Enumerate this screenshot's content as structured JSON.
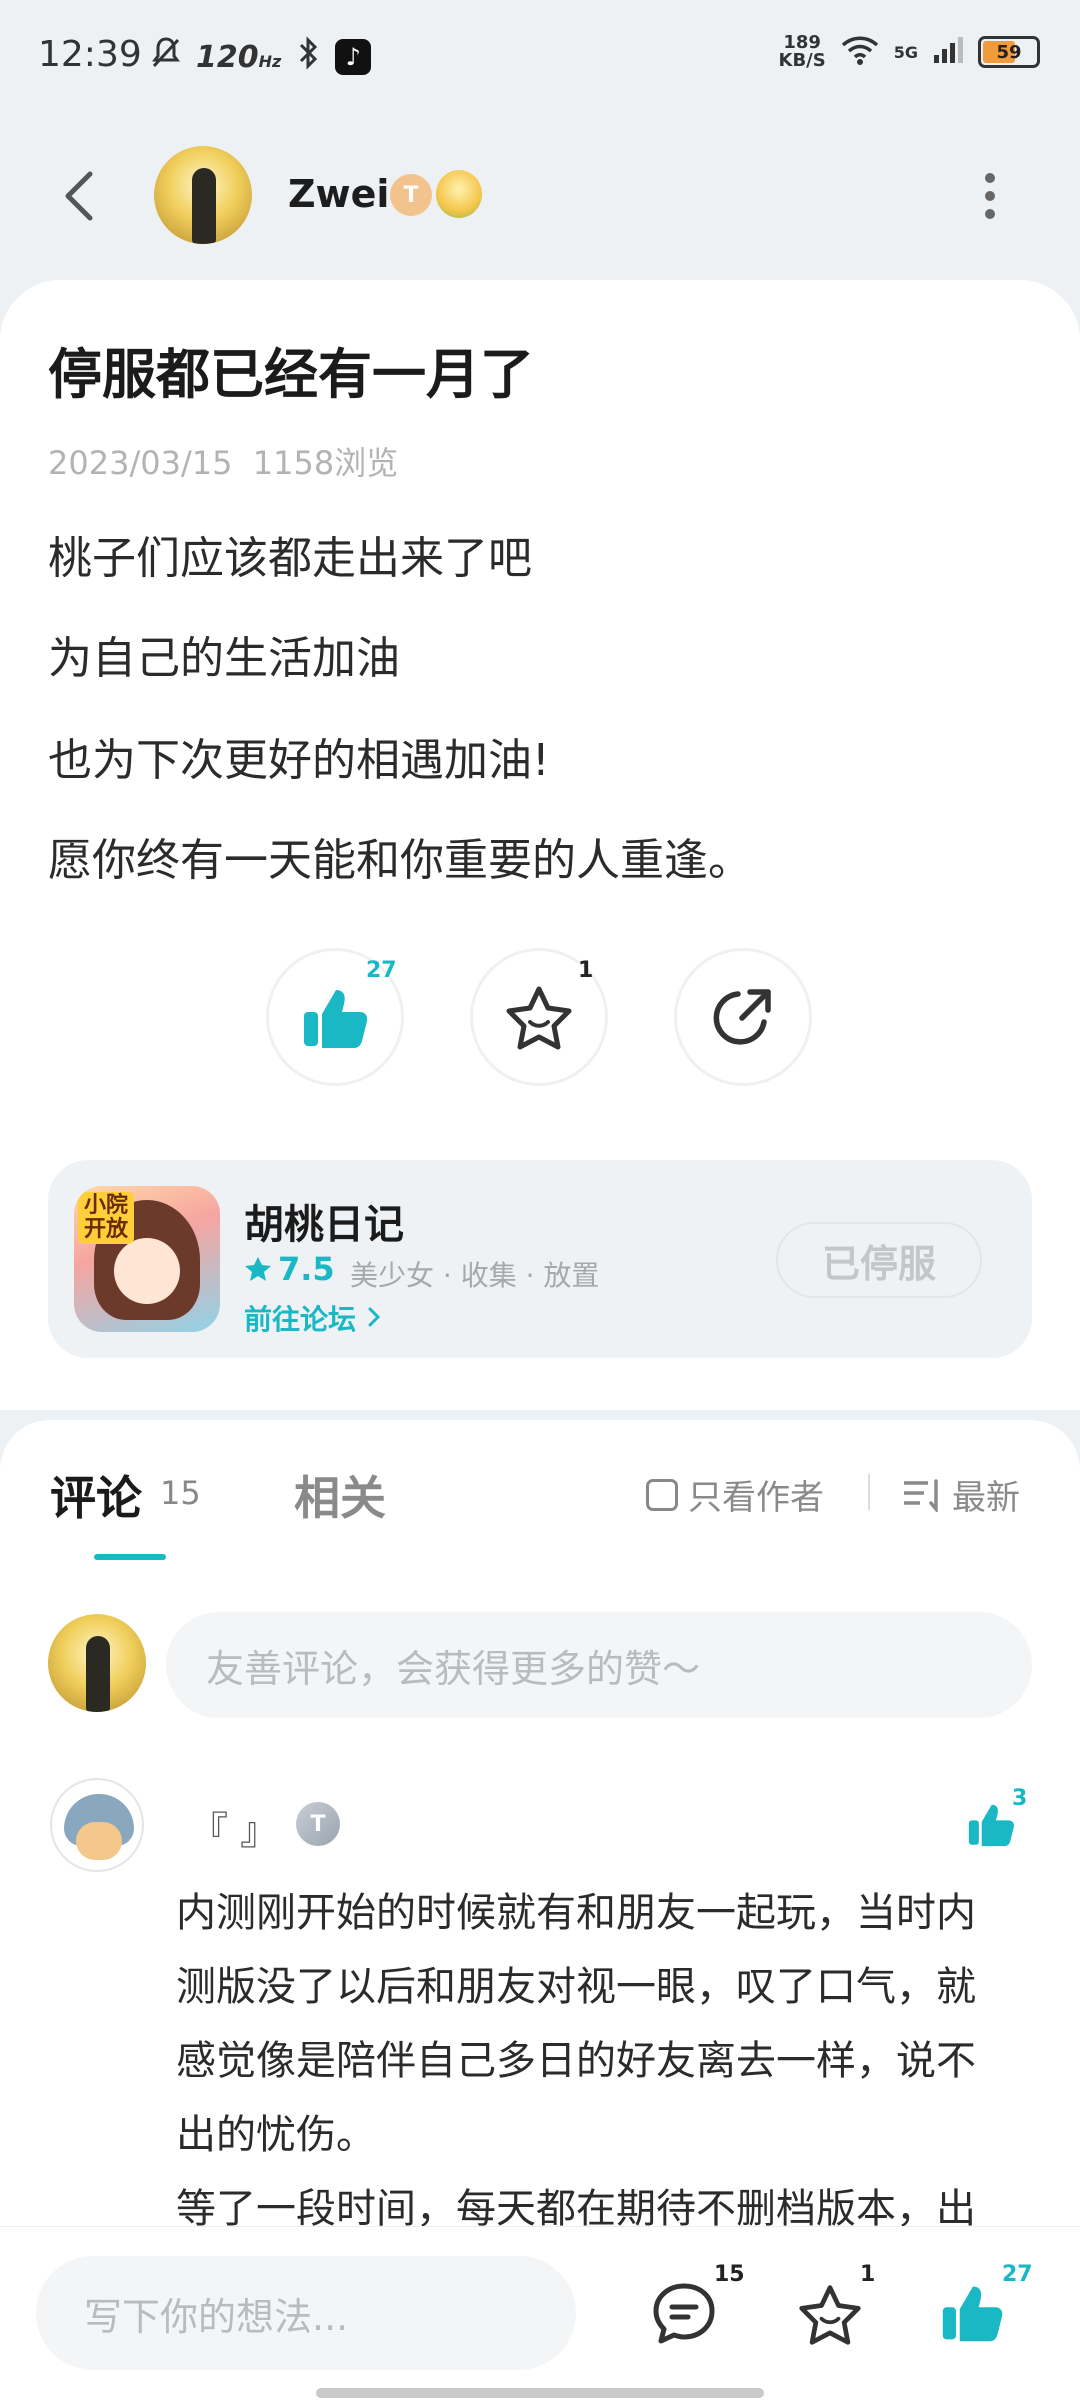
{
  "status_bar": {
    "time": "12:39",
    "refresh_rate": "120",
    "refresh_unit": "Hz",
    "net_speed": "189",
    "net_unit": "KB/S",
    "network": "5G",
    "battery": "59"
  },
  "header": {
    "author_name": "Zwei",
    "author_badge": "T"
  },
  "post": {
    "title": "停服都已经有一月了",
    "date": "2023/03/15",
    "views": "1158浏览",
    "lines": [
      "桃子们应该都走出来了吧",
      "为自己的生活加油",
      "也为下次更好的相遇加油!",
      "愿你终有一天能和你重要的人重逢。"
    ],
    "like_count": "27",
    "fav_count": "1"
  },
  "game": {
    "icon_tag": "小院开放",
    "name": "胡桃日记",
    "rating": "7.5",
    "tags": "美少女 · 收集 · 放置",
    "link": "前往论坛",
    "status": "已停服"
  },
  "comments": {
    "tab_comments": "评论",
    "tab_comments_count": "15",
    "tab_related": "相关",
    "author_only": "只看作者",
    "sort": "最新",
    "input_placeholder": "友善评论，会获得更多的赞～",
    "first": {
      "name": "『 』",
      "badge": "T",
      "like_count": "3",
      "text_lines": [
        " 内测刚开始的时候就有和朋友一起玩，当时内",
        "测版没了以后和朋友对视一眼，叹了口气，就",
        "感觉像是陪伴自己多日的好友离去一样，说不",
        "出的忧伤。",
        "等了一段时间，每天都在期待不删档版本，出"
      ]
    }
  },
  "bottom_bar": {
    "placeholder": "写下你的想法...",
    "comment_count": "15",
    "fav_count": "1",
    "like_count": "27"
  },
  "colors": {
    "accent": "#19b8c4",
    "background": "#eef1f4"
  }
}
